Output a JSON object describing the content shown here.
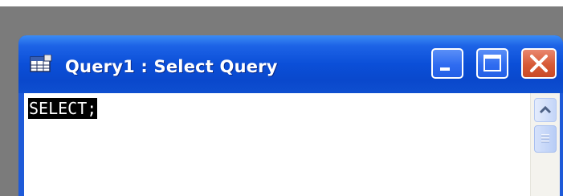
{
  "window": {
    "title": "Query1 : Select Query",
    "icon": "query-datasheet-icon",
    "controls": {
      "minimize": "minimize-icon",
      "maximize": "maximize-icon",
      "close": "close-icon"
    },
    "colors": {
      "titlebar": "#0a48cc",
      "close_button": "#d75a36",
      "selection_bg": "#000000",
      "selection_fg": "#ffffff"
    }
  },
  "editor": {
    "sql_text": "SELECT;",
    "selected": true
  },
  "scrollbar": {
    "up_icon": "chevron-up-icon",
    "thumb_icon": "grip-icon"
  }
}
